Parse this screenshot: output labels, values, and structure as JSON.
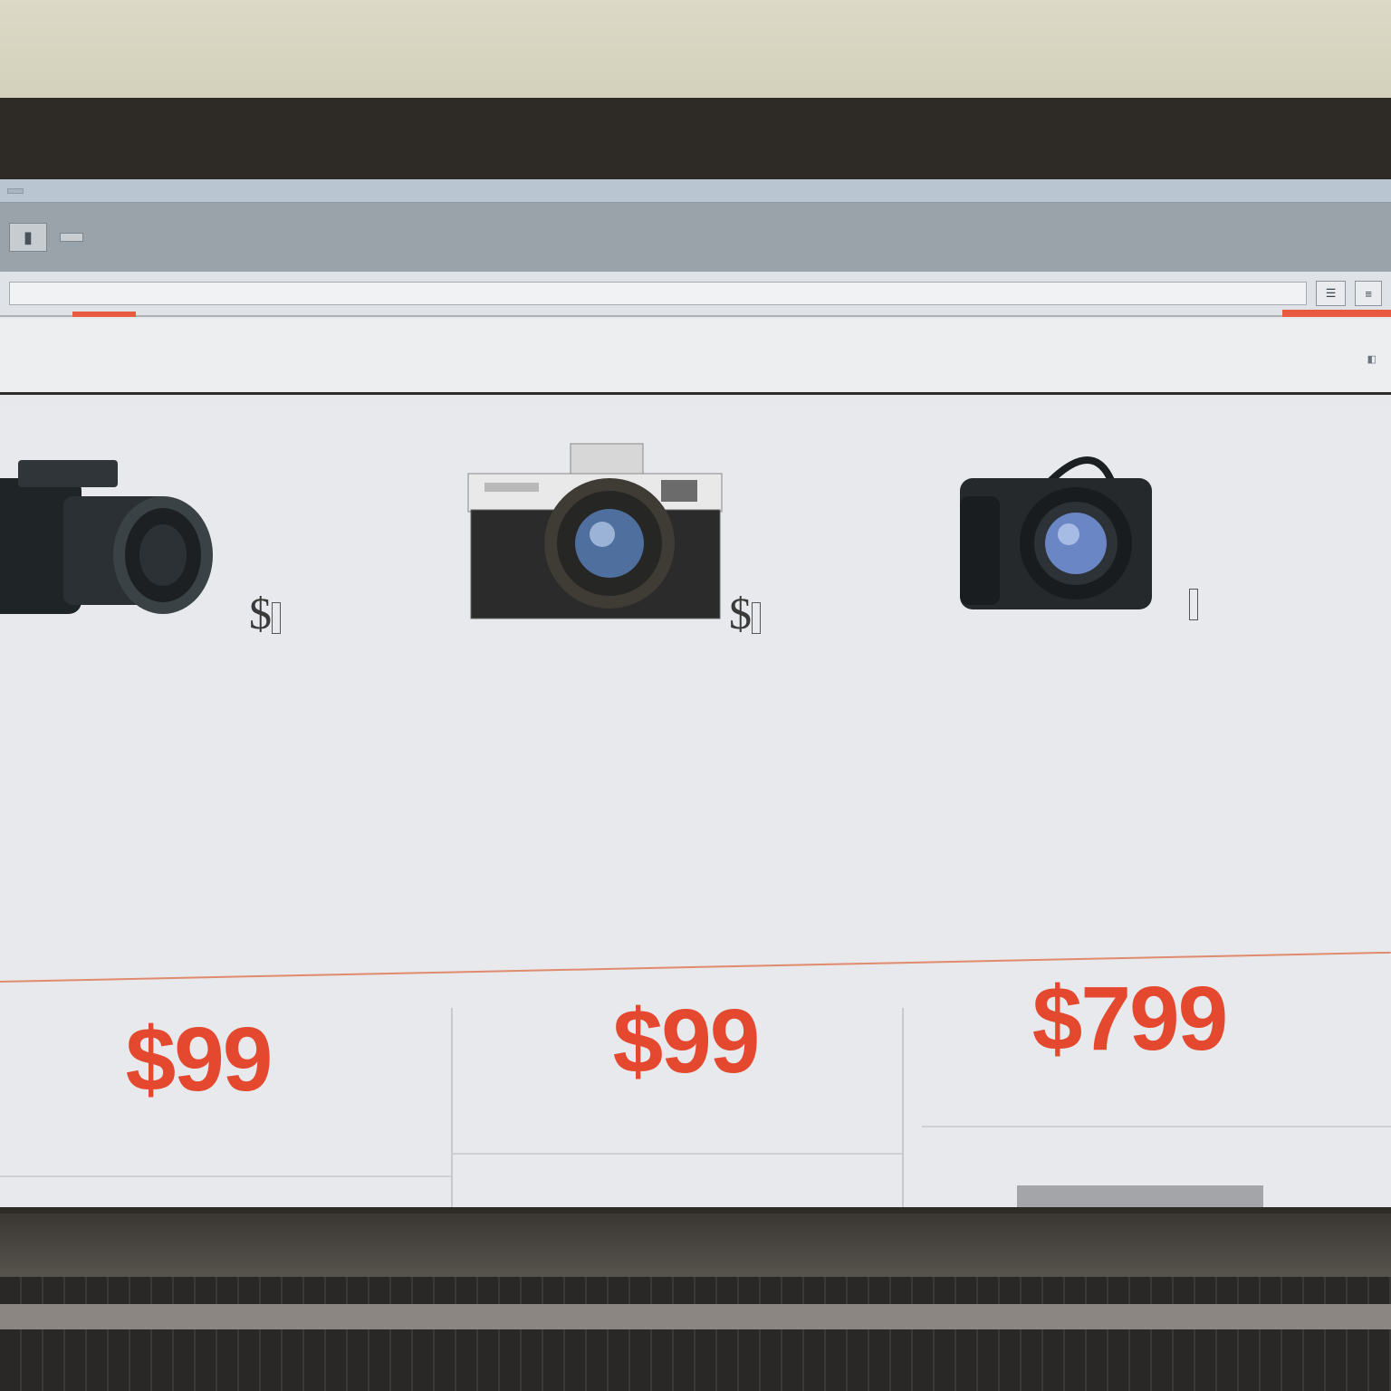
{
  "browser": {
    "tab_label": "",
    "tab_right_label": ""
  },
  "site": {
    "title": "",
    "header_links": ""
  },
  "address_bar": {
    "url": ""
  },
  "filter": {
    "label": ""
  },
  "products": [
    {
      "name": "dslr-camera",
      "tag_symbol": "$",
      "tag_label": ""
    },
    {
      "name": "film-camera",
      "tag_symbol": "$",
      "tag_label": ""
    },
    {
      "name": "mirrorless-camera",
      "tag_symbol": "",
      "tag_label": ""
    }
  ],
  "plans": [
    {
      "price": "$99",
      "description": "",
      "cta_label": "",
      "cta_color": "#a3a5a8"
    },
    {
      "price": "$99",
      "description": "",
      "cta_label": "",
      "cta_color": "#e4492f"
    },
    {
      "price": "$799",
      "description": "",
      "cta_label": "",
      "cta_color": "#a3a5a8"
    }
  ],
  "colors": {
    "accent": "#e4492f",
    "chrome": "#9aa2aa",
    "bezel": "#2e2b27"
  }
}
